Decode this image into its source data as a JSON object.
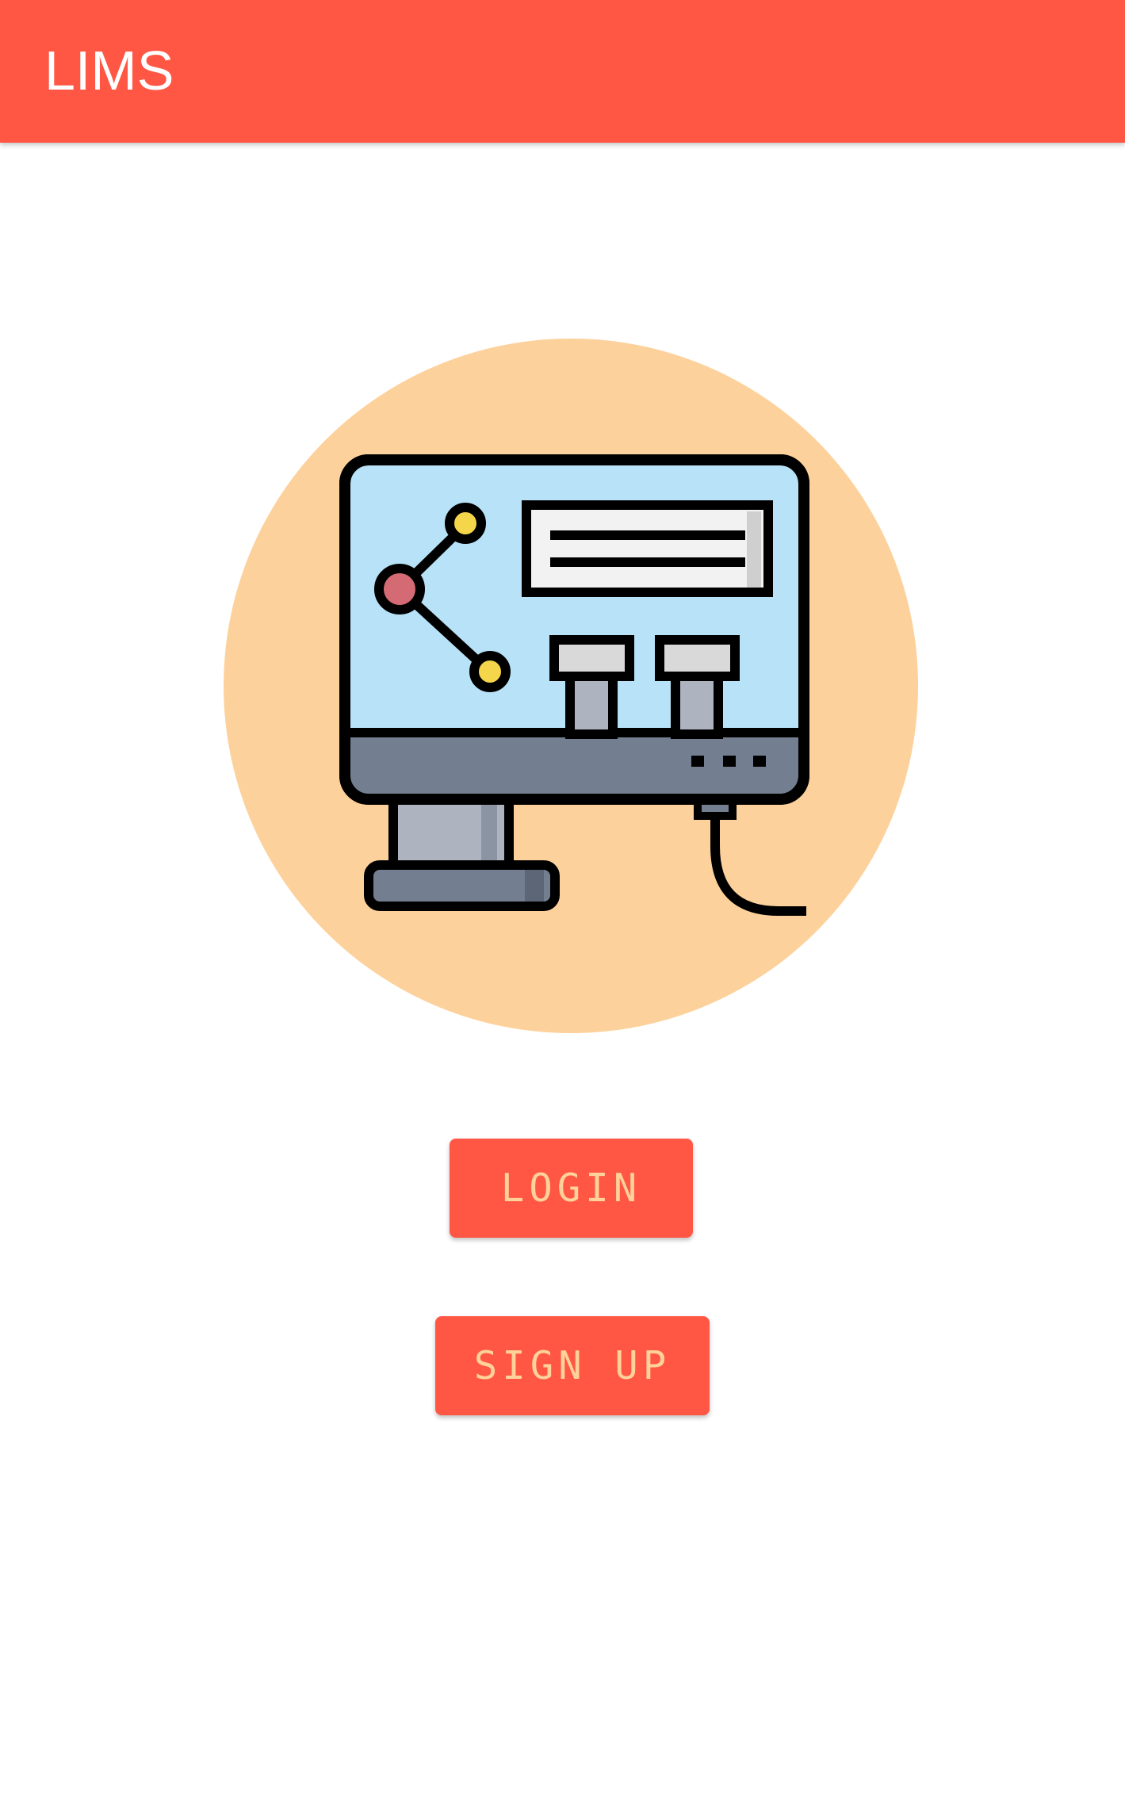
{
  "app_bar": {
    "title": "LIMS"
  },
  "hero": {
    "icon": "lab-computer-icon"
  },
  "buttons": {
    "login_label": "LOGIN",
    "signup_label": "SIGN UP"
  },
  "colors": {
    "primary": "#ff5744",
    "button_text": "#ffd19b",
    "hero_circle": "#fdd19b",
    "screen": "#b7e2f7",
    "monitor_base": "#737f91"
  }
}
